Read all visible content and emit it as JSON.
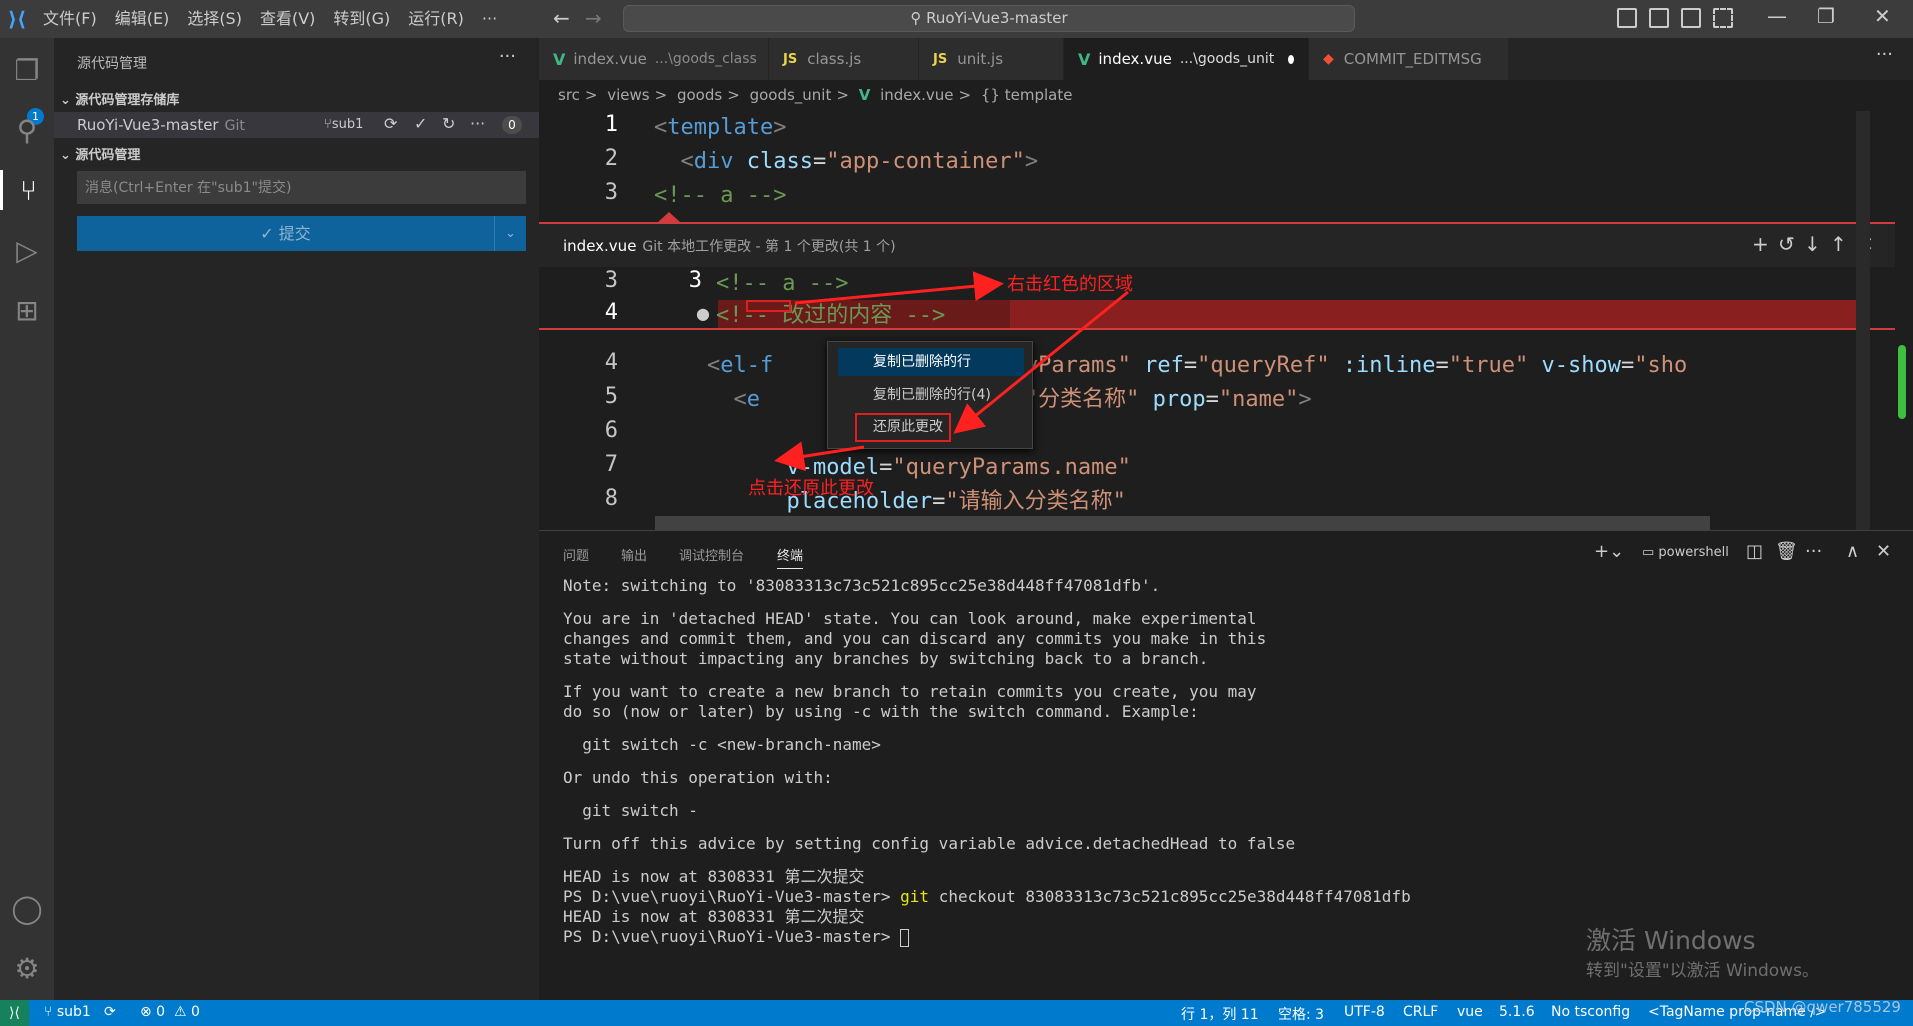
{
  "titlebar": {
    "menus": [
      "文件(F)",
      "编辑(E)",
      "选择(S)",
      "查看(V)",
      "转到(G)",
      "运行(R)",
      "···"
    ],
    "search_text": "RuoYi-Vue3-master"
  },
  "sidebar": {
    "title": "源代码管理",
    "repos_header": "源代码管理存储库",
    "repo_name": "RuoYi-Vue3-master",
    "repo_type": "Git",
    "branch": "sub1",
    "change_count": "0",
    "scm_header": "源代码管理",
    "commit_placeholder": "消息(Ctrl+Enter 在\"sub1\"提交)",
    "commit_label": "✓ 提交"
  },
  "activity_badge": "1",
  "tabs": [
    {
      "icon": "vue",
      "label": "index.vue",
      "path": "...\\goods_class"
    },
    {
      "icon": "js",
      "label": "class.js",
      "path": ""
    },
    {
      "icon": "js",
      "label": "unit.js",
      "path": ""
    },
    {
      "icon": "vue",
      "label": "index.vue",
      "path": "...\\goods_unit"
    },
    {
      "icon": "git",
      "label": "COMMIT_EDITMSG",
      "path": ""
    }
  ],
  "breadcrumb": [
    "src",
    ">",
    "views",
    ">",
    "goods",
    ">",
    "goods_unit",
    ">",
    "index.vue",
    ">",
    "{} template"
  ],
  "peek": {
    "file": "index.vue",
    "desc": "Git 本地工作更改 - 第 1 个更改(共 1 个)"
  },
  "context_menu": {
    "items": [
      "复制已删除的行",
      "复制已删除的行(4)",
      "还原此更改"
    ]
  },
  "annotations": {
    "right_click": "右击红色的区域",
    "click_revert": "点击还原此更改"
  },
  "panel": {
    "tabs": [
      "问题",
      "输出",
      "调试控制台",
      "终端"
    ],
    "shell": "powershell",
    "terminal_lines": [
      "Note: switching to '83083313c73c521c895cc25e38d448ff47081dfb'.",
      "",
      "You are in 'detached HEAD' state. You can look around, make experimental",
      "changes and commit them, and you can discard any commits you make in this",
      "state without impacting any branches by switching back to a branch.",
      "",
      "If you want to create a new branch to retain commits you create, you may",
      "do so (now or later) by using -c with the switch command. Example:",
      "",
      "  git switch -c <new-branch-name>",
      "",
      "Or undo this operation with:",
      "",
      "  git switch -",
      "",
      "Turn off this advice by setting config variable advice.detachedHead to false",
      "",
      "HEAD is now at 8308331 第二次提交"
    ],
    "prompt1": "PS D:\\vue\\ruoyi\\RuoYi-Vue3-master> ",
    "cmd": "git",
    "cmd_args": " checkout 83083313c73c521c895cc25e38d448ff47081dfb",
    "head_line": "HEAD is now at 8308331 第二次提交",
    "prompt2": "PS D:\\vue\\ruoyi\\RuoYi-Vue3-master> "
  },
  "watermark": {
    "line1": "激活 Windows",
    "line2": "转到\"设置\"以激活 Windows。"
  },
  "statusbar": {
    "branch": "sub1",
    "errors": "⊗ 0",
    "warnings": "⚠ 0",
    "position": "行 1，列 11",
    "spaces": "空格: 3",
    "encoding": "UTF-8",
    "eol": "CRLF",
    "language": "vue",
    "version": "5.1.6",
    "tsconfig": "No tsconfig",
    "tagname": "<TagName prop-name />",
    "csdn": "CSDN @qwer785529"
  },
  "colors": {
    "accent": "#007acc",
    "diff_red": "#d13b3b",
    "annotation_red": "#ff2020"
  }
}
